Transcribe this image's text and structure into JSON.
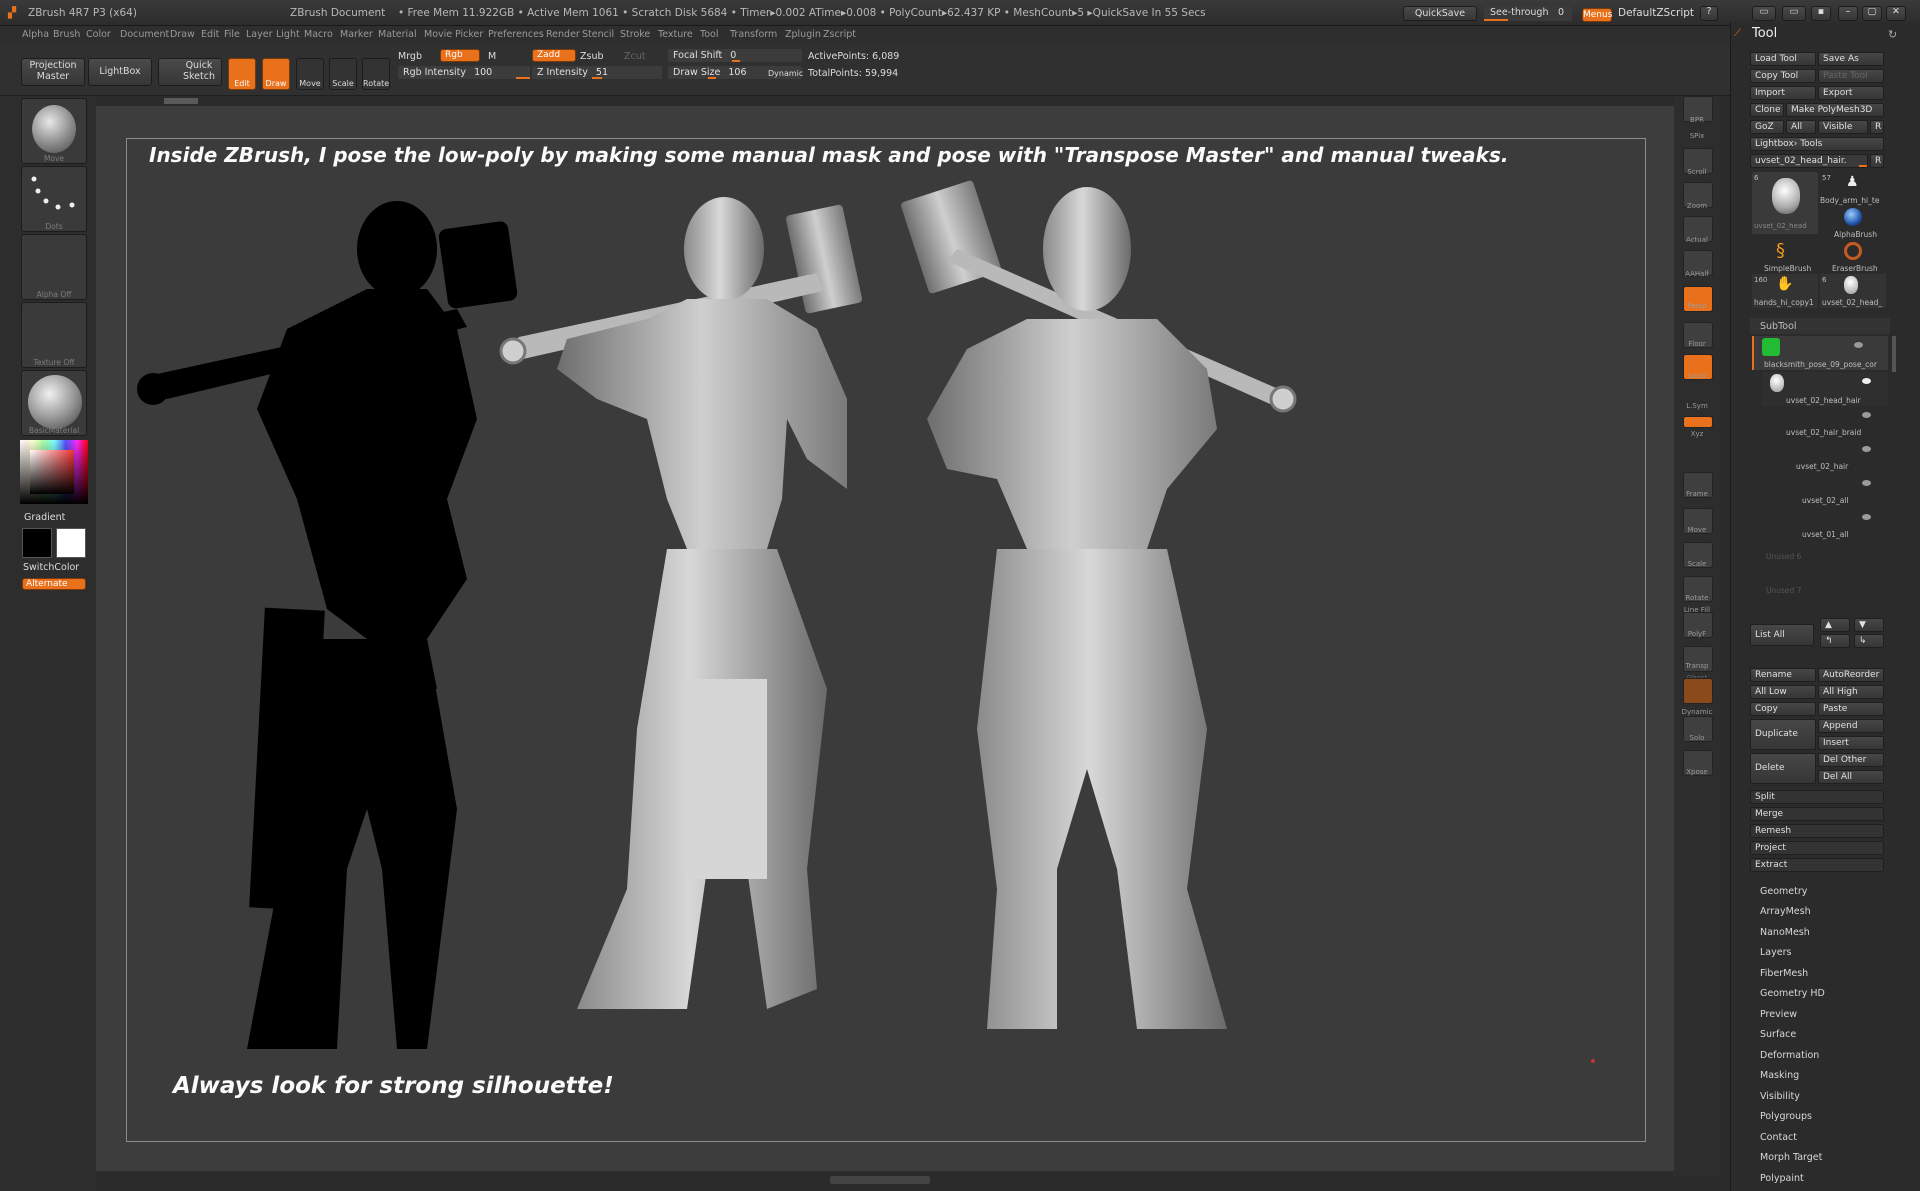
{
  "titlebar": {
    "app": "ZBrush 4R7 P3 (x64)",
    "document": "ZBrush Document",
    "stats": "• Free Mem 11.922GB • Active Mem 1061 • Scratch Disk 5684 • Timer▸0.002 ATime▸0.008 • PolyCount▸62.437 KP • MeshCount▸5 ▸QuickSave In 55 Secs",
    "quicksave": "QuickSave",
    "seethrough": "See-through",
    "seethrough_value": "0",
    "menus": "Menus",
    "zscript": "DefaultZScript"
  },
  "menubar": [
    "Alpha",
    "Brush",
    "Color",
    "Document",
    "Draw",
    "Edit",
    "File",
    "Layer",
    "Light",
    "Macro",
    "Marker",
    "Material",
    "Movie",
    "Picker",
    "Preferences",
    "Render",
    "Stencil",
    "Stroke",
    "Texture",
    "Tool",
    "Transform",
    "Zplugin",
    "Zscript"
  ],
  "topshelf": {
    "projection_master": "Projection Master",
    "lightbox": "LightBox",
    "quick_sketch": "Quick Sketch",
    "edit": "Edit",
    "draw": "Draw",
    "move": "Move",
    "scale": "Scale",
    "rotate": "Rotate",
    "mrgb": "Mrgb",
    "rgb": "Rgb",
    "m": "M",
    "zadd": "Zadd",
    "zsub": "Zsub",
    "zcut": "Zcut",
    "rgb_intensity_label": "Rgb Intensity",
    "rgb_intensity": "100",
    "z_intensity_label": "Z Intensity",
    "z_intensity": "51",
    "focal_shift_label": "Focal Shift",
    "focal_shift": "0",
    "draw_size_label": "Draw Size",
    "draw_size": "106",
    "dynamic": "Dynamic",
    "active_points": "ActivePoints: 6,089",
    "total_points": "TotalPoints: 59,994"
  },
  "leftshelf": {
    "brush": "Move",
    "stroke": "Dots",
    "alpha": "Alpha Off",
    "texture": "Texture Off",
    "material": "BasicMaterial",
    "gradient": "Gradient",
    "switchcolor": "SwitchColor",
    "alternate": "Alternate"
  },
  "canvas": {
    "caption_top": "Inside ZBrush, I pose the low-poly by making some manual mask and pose with \"Transpose Master\" and manual tweaks.",
    "caption_bottom": "Always look for strong silhouette!"
  },
  "rightshelf": [
    "BPR",
    "SPix",
    "Scroll",
    "Zoom",
    "Actual",
    "AAHalf",
    "Persp",
    "Floor",
    "Local",
    "L.Sym",
    "Xyz",
    "Frame",
    "Move",
    "Scale",
    "Rotate",
    "Line Fill",
    "PolyF",
    "Transp",
    "Ghost",
    "Dynamic",
    "Solo",
    "Xpose"
  ],
  "toolpanel": {
    "title": "Tool",
    "load_tool": "Load Tool",
    "save_as": "Save As",
    "copy_tool": "Copy Tool",
    "paste_tool": "Paste Tool",
    "import": "Import",
    "export": "Export",
    "clone": "Clone",
    "make_polymesh": "Make PolyMesh3D",
    "goz": "GoZ",
    "all": "All",
    "visible": "Visible",
    "r": "R",
    "lightbox_tools": "Lightbox› Tools",
    "current_tool": "uvset_02_head_hair.",
    "current_tool_count": "6",
    "thumbs": [
      {
        "label": "uvset_02_head",
        "count": "6"
      },
      {
        "label": "Body_arm_hi_te",
        "count": "57"
      },
      {
        "label": "AlphaBrush",
        "count": ""
      },
      {
        "label": "SimpleBrush",
        "count": ""
      },
      {
        "label": "EraserBrush",
        "count": ""
      },
      {
        "label": "hands_hi_copy1",
        "count": "160"
      },
      {
        "label": "uvset_02_head_",
        "count": "6"
      }
    ],
    "subtool_title": "SubTool",
    "subtools": [
      "blacksmith_pose_09_pose_cor",
      "uvset_02_head_hair",
      "uvset_02_hair_braid",
      "uvset_02_hair",
      "uvset_02_all",
      "uvset_01_all"
    ],
    "unused": [
      "Unused 6",
      "Unused 7"
    ],
    "list_all": "List All",
    "rename": "Rename",
    "autoreorder": "AutoReorder",
    "all_low": "All Low",
    "all_high": "All High",
    "copy": "Copy",
    "paste": "Paste",
    "duplicate": "Duplicate",
    "append": "Append",
    "insert": "Insert",
    "delete": "Delete",
    "del_other": "Del Other",
    "del_all": "Del All",
    "actions": [
      "Split",
      "Merge",
      "Remesh",
      "Project",
      "Extract"
    ],
    "sections": [
      "Geometry",
      "ArrayMesh",
      "NanoMesh",
      "Layers",
      "FiberMesh",
      "Geometry HD",
      "Preview",
      "Surface",
      "Deformation",
      "Masking",
      "Visibility",
      "Polygroups",
      "Contact",
      "Morph Target",
      "Polypaint"
    ]
  }
}
